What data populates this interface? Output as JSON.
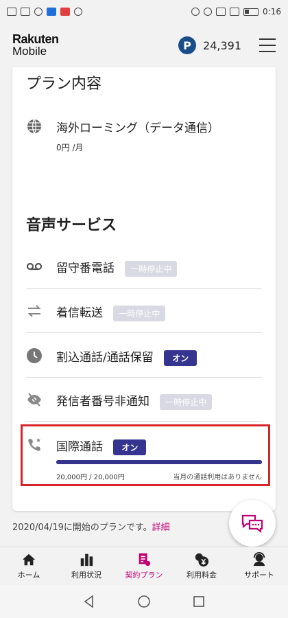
{
  "status_bar": {
    "time": "0:16",
    "left_icons": [
      "hd-icon",
      "signal-icon",
      "wifi-icon",
      "shield-icon",
      "huawei-icon",
      "location-icon"
    ],
    "right_icons": [
      "eye-icon",
      "alarm-icon",
      "bluetooth-icon",
      "vibrate-icon",
      "battery-icon"
    ]
  },
  "header": {
    "logo_line1": "Rakuten",
    "logo_line2": "Mobile",
    "points_badge": "P",
    "points": "24,391"
  },
  "plan": {
    "title": "プラン内容",
    "roaming_label": "海外ローミング（データ通信）",
    "roaming_price": "0円 /月"
  },
  "voice": {
    "title": "音声サービス",
    "items": [
      {
        "label": "留守番電話",
        "status": "一時停止中"
      },
      {
        "label": "着信転送",
        "status": "一時停止中"
      },
      {
        "label": "割込通話/通話保留",
        "status": "オン"
      },
      {
        "label": "発信者番号非通知",
        "status": "一時停止中"
      },
      {
        "label": "国際通話",
        "status": "オン"
      }
    ],
    "intl_usage": "20,000円 / 20,000円",
    "intl_usage_fraction": 1.0,
    "intl_note": "当月の通話利用はありません"
  },
  "footer_note": {
    "text": "2020/04/19に開始のプランです。",
    "link": "詳細"
  },
  "bottom_nav": [
    {
      "label": "ホーム",
      "icon": "home-icon",
      "active": false
    },
    {
      "label": "利用状況",
      "icon": "bar-chart-icon",
      "active": false
    },
    {
      "label": "契約プラン",
      "icon": "contract-icon",
      "active": true
    },
    {
      "label": "利用料金",
      "icon": "yen-icon",
      "active": false
    },
    {
      "label": "サポート",
      "icon": "support-icon",
      "active": false
    }
  ],
  "colors": {
    "accent": "#bf0073",
    "on_badge": "#35358f",
    "pause_badge": "#d9d9e3",
    "highlight": "#d8232a"
  }
}
